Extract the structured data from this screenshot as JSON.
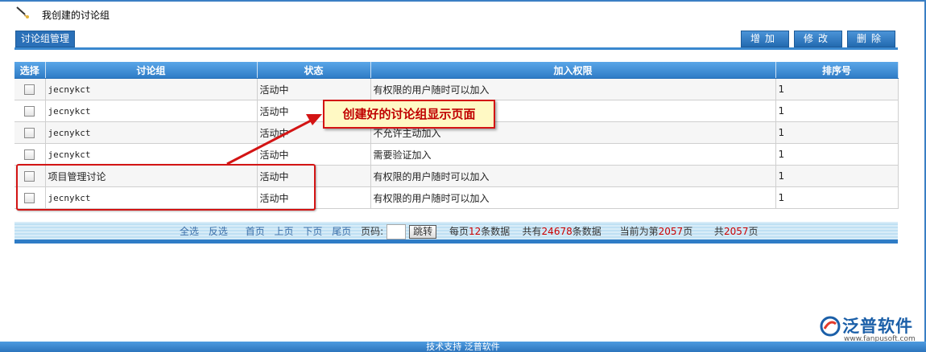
{
  "page": {
    "title": "我创建的讨论组"
  },
  "toolbar": {
    "tab_label": "讨论组管理",
    "add_label": "增加",
    "edit_label": "修改",
    "delete_label": "删除"
  },
  "table": {
    "headers": [
      "选择",
      "讨论组",
      "状态",
      "加入权限",
      "排序号"
    ],
    "rows": [
      {
        "name": "jecnykct",
        "status": "活动中",
        "permission": "有权限的用户随时可以加入",
        "order": "1"
      },
      {
        "name": "jecnykct",
        "status": "活动中",
        "permission": "",
        "order": "1"
      },
      {
        "name": "jecnykct",
        "status": "活动中",
        "permission": "不允许主动加入",
        "order": "1"
      },
      {
        "name": "jecnykct",
        "status": "活动中",
        "permission": "需要验证加入",
        "order": "1"
      },
      {
        "name": "项目管理讨论",
        "status": "活动中",
        "permission": "有权限的用户随时可以加入",
        "order": "1"
      },
      {
        "name": "jecnykct",
        "status": "活动中",
        "permission": "有权限的用户随时可以加入",
        "order": "1"
      }
    ]
  },
  "pager": {
    "select_all": "全选",
    "invert": "反选",
    "first": "首页",
    "prev": "上页",
    "next": "下页",
    "last": "尾页",
    "page_label": "页码:",
    "jump": "跳转",
    "per_page_prefix": "每页",
    "per_page": "12",
    "per_page_suffix": "条数据",
    "total_prefix": "共有",
    "total": "24678",
    "total_suffix": "条数据",
    "current_prefix": "当前为第",
    "current": "2057",
    "current_suffix": "页",
    "pages_prefix": "共",
    "pages": "2057",
    "pages_suffix": "页"
  },
  "annotation": {
    "callout": "创建好的讨论组显示页面"
  },
  "logo": {
    "name": "泛普软件",
    "url": "www.fanpusoft.com"
  },
  "footer": {
    "text": "技术支持 泛普软件"
  },
  "colors": {
    "accent": "#2f7cc6",
    "callout_border": "#d31414",
    "callout_bg": "#fff9c4",
    "red_number": "#cc0000"
  },
  "icons": {
    "title": "pen-icon",
    "logo": "fanpu-logo-icon"
  }
}
